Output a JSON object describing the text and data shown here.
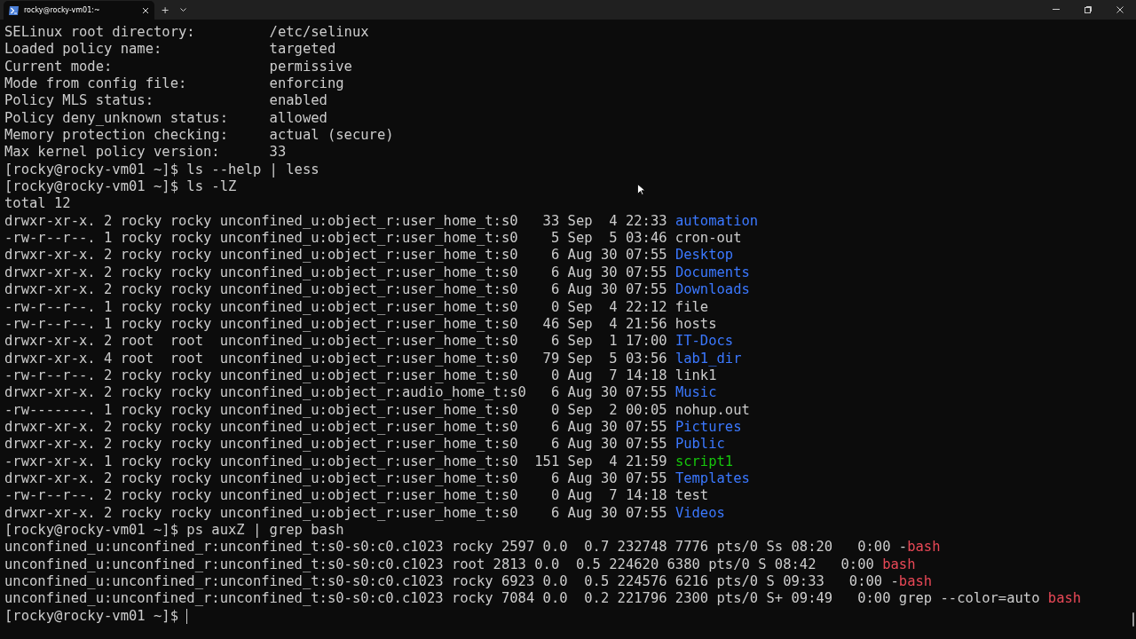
{
  "window": {
    "tabs": [
      {
        "title": "rocky@rocky-vm01:~",
        "selected": true
      }
    ],
    "new_tab": "+"
  },
  "terminal": {
    "lines": [
      {
        "segments": [
          {
            "text": "SELinux root directory:         /etc/selinux",
            "kind": "plain"
          }
        ]
      },
      {
        "segments": [
          {
            "text": "Loaded policy name:             targeted",
            "kind": "plain"
          }
        ]
      },
      {
        "segments": [
          {
            "text": "Current mode:                   permissive",
            "kind": "plain"
          }
        ]
      },
      {
        "segments": [
          {
            "text": "Mode from config file:          enforcing",
            "kind": "plain"
          }
        ]
      },
      {
        "segments": [
          {
            "text": "Policy MLS status:              enabled",
            "kind": "plain"
          }
        ]
      },
      {
        "segments": [
          {
            "text": "Policy deny_unknown status:     allowed",
            "kind": "plain"
          }
        ]
      },
      {
        "segments": [
          {
            "text": "Memory protection checking:     actual (secure)",
            "kind": "plain"
          }
        ]
      },
      {
        "segments": [
          {
            "text": "Max kernel policy version:      33",
            "kind": "plain"
          }
        ]
      },
      {
        "segments": [
          {
            "text": "[rocky@rocky-vm01 ~]$ ls --help | less",
            "kind": "plain"
          }
        ]
      },
      {
        "segments": [
          {
            "text": "[rocky@rocky-vm01 ~]$ ls -lZ",
            "kind": "plain"
          }
        ]
      },
      {
        "segments": [
          {
            "text": "total 12",
            "kind": "plain"
          }
        ]
      },
      {
        "segments": [
          {
            "text": "drwxr-xr-x. 2 rocky rocky unconfined_u:object_r:user_home_t:s0   33 Sep  4 22:33 ",
            "kind": "plain"
          },
          {
            "text": "automation",
            "kind": "directory"
          }
        ]
      },
      {
        "segments": [
          {
            "text": "-rw-r--r--. 1 rocky rocky unconfined_u:object_r:user_home_t:s0    5 Sep  5 03:46 cron-out",
            "kind": "plain"
          }
        ]
      },
      {
        "segments": [
          {
            "text": "drwxr-xr-x. 2 rocky rocky unconfined_u:object_r:user_home_t:s0    6 Aug 30 07:55 ",
            "kind": "plain"
          },
          {
            "text": "Desktop",
            "kind": "directory"
          }
        ]
      },
      {
        "segments": [
          {
            "text": "drwxr-xr-x. 2 rocky rocky unconfined_u:object_r:user_home_t:s0    6 Aug 30 07:55 ",
            "kind": "plain"
          },
          {
            "text": "Documents",
            "kind": "directory"
          }
        ]
      },
      {
        "segments": [
          {
            "text": "drwxr-xr-x. 2 rocky rocky unconfined_u:object_r:user_home_t:s0    6 Aug 30 07:55 ",
            "kind": "plain"
          },
          {
            "text": "Downloads",
            "kind": "directory"
          }
        ]
      },
      {
        "segments": [
          {
            "text": "-rw-r--r--. 1 rocky rocky unconfined_u:object_r:user_home_t:s0    0 Sep  4 22:12 file",
            "kind": "plain"
          }
        ]
      },
      {
        "segments": [
          {
            "text": "-rw-r--r--. 1 rocky rocky unconfined_u:object_r:user_home_t:s0   46 Sep  4 21:56 hosts",
            "kind": "plain"
          }
        ]
      },
      {
        "segments": [
          {
            "text": "drwxr-xr-x. 2 root  root  unconfined_u:object_r:user_home_t:s0    6 Sep  1 17:00 ",
            "kind": "plain"
          },
          {
            "text": "IT-Docs",
            "kind": "directory"
          }
        ]
      },
      {
        "segments": [
          {
            "text": "drwxr-xr-x. 4 root  root  unconfined_u:object_r:user_home_t:s0   79 Sep  5 03:56 ",
            "kind": "plain"
          },
          {
            "text": "lab1_dir",
            "kind": "directory"
          }
        ]
      },
      {
        "segments": [
          {
            "text": "-rw-r--r--. 2 rocky rocky unconfined_u:object_r:user_home_t:s0    0 Aug  7 14:18 link1",
            "kind": "plain"
          }
        ]
      },
      {
        "segments": [
          {
            "text": "drwxr-xr-x. 2 rocky rocky unconfined_u:object_r:audio_home_t:s0   6 Aug 30 07:55 ",
            "kind": "plain"
          },
          {
            "text": "Music",
            "kind": "directory"
          }
        ]
      },
      {
        "segments": [
          {
            "text": "-rw-------. 1 rocky rocky unconfined_u:object_r:user_home_t:s0    0 Sep  2 00:05 nohup.out",
            "kind": "plain"
          }
        ]
      },
      {
        "segments": [
          {
            "text": "drwxr-xr-x. 2 rocky rocky unconfined_u:object_r:user_home_t:s0    6 Aug 30 07:55 ",
            "kind": "plain"
          },
          {
            "text": "Pictures",
            "kind": "directory"
          }
        ]
      },
      {
        "segments": [
          {
            "text": "drwxr-xr-x. 2 rocky rocky unconfined_u:object_r:user_home_t:s0    6 Aug 30 07:55 ",
            "kind": "plain"
          },
          {
            "text": "Public",
            "kind": "directory"
          }
        ]
      },
      {
        "segments": [
          {
            "text": "-rwxr-xr-x. 1 rocky rocky unconfined_u:object_r:user_home_t:s0  151 Sep  4 21:59 ",
            "kind": "plain"
          },
          {
            "text": "script1",
            "kind": "executable"
          }
        ]
      },
      {
        "segments": [
          {
            "text": "drwxr-xr-x. 2 rocky rocky unconfined_u:object_r:user_home_t:s0    6 Aug 30 07:55 ",
            "kind": "plain"
          },
          {
            "text": "Templates",
            "kind": "directory"
          }
        ]
      },
      {
        "segments": [
          {
            "text": "-rw-r--r--. 2 rocky rocky unconfined_u:object_r:user_home_t:s0    0 Aug  7 14:18 test",
            "kind": "plain"
          }
        ]
      },
      {
        "segments": [
          {
            "text": "drwxr-xr-x. 2 rocky rocky unconfined_u:object_r:user_home_t:s0    6 Aug 30 07:55 ",
            "kind": "plain"
          },
          {
            "text": "Videos",
            "kind": "directory"
          }
        ]
      },
      {
        "segments": [
          {
            "text": "[rocky@rocky-vm01 ~]$ ps auxZ | grep bash",
            "kind": "plain"
          }
        ]
      },
      {
        "segments": [
          {
            "text": "unconfined_u:unconfined_r:unconfined_t:s0-s0:c0.c1023 rocky 2597 0.0  0.7 232748 7776 pts/0 Ss 08:20   0:00 -",
            "kind": "plain"
          },
          {
            "text": "bash",
            "kind": "match"
          }
        ]
      },
      {
        "segments": [
          {
            "text": "unconfined_u:unconfined_r:unconfined_t:s0-s0:c0.c1023 root 2813 0.0  0.5 224620 6380 pts/0 S 08:42   0:00 ",
            "kind": "plain"
          },
          {
            "text": "bash",
            "kind": "match"
          }
        ]
      },
      {
        "segments": [
          {
            "text": "unconfined_u:unconfined_r:unconfined_t:s0-s0:c0.c1023 rocky 6923 0.0  0.5 224576 6216 pts/0 S 09:33   0:00 -",
            "kind": "plain"
          },
          {
            "text": "bash",
            "kind": "match"
          }
        ]
      },
      {
        "segments": [
          {
            "text": "unconfined_u:unconfined_r:unconfined_t:s0-s0:c0.c1023 rocky 7084 0.0  0.2 221796 2300 pts/0 S+ 09:49   0:00 grep --color=auto ",
            "kind": "plain"
          },
          {
            "text": "bash",
            "kind": "match"
          }
        ]
      },
      {
        "segments": [
          {
            "text": "[rocky@rocky-vm01 ~]$ ",
            "kind": "plain"
          }
        ],
        "cursor": true
      }
    ]
  }
}
